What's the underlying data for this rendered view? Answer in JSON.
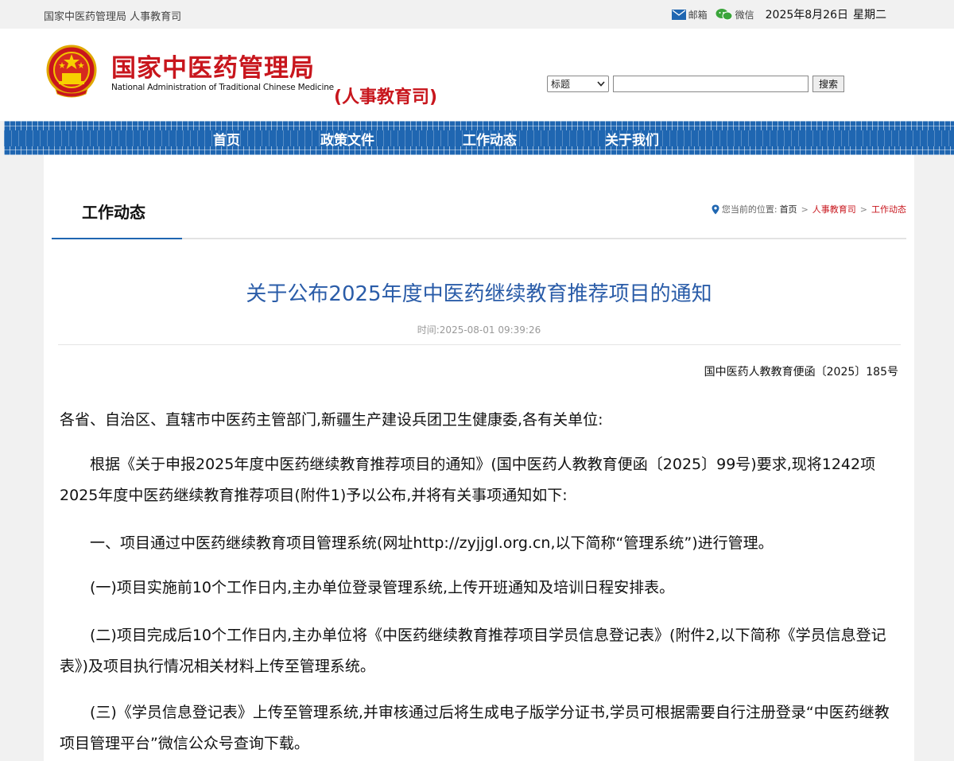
{
  "topbar": {
    "site_label": "国家中医药管理局 人事教育司",
    "mail_label": "邮箱",
    "wechat_label": "微信",
    "date": "2025年8月26日",
    "weekday": "星期二"
  },
  "header": {
    "logo_cn": "国家中医药管理局",
    "logo_en": "National Administration of Traditional Chinese Medicine",
    "logo_sub": "(人事教育司)",
    "search": {
      "select_value": "标题",
      "input_value": "",
      "button_label": "搜索"
    }
  },
  "nav": {
    "items": [
      {
        "label": "首页"
      },
      {
        "label": "政策文件"
      },
      {
        "label": "工作动态"
      },
      {
        "label": "关于我们"
      }
    ]
  },
  "section": {
    "title": "工作动态",
    "breadcrumb": {
      "prefix": "您当前的位置:",
      "home": "首页",
      "level1": "人事教育司",
      "level2": "工作动态",
      "separator": ">"
    }
  },
  "article": {
    "title": "关于公布2025年度中医药继续教育推荐项目的通知",
    "time": "时间:2025-08-01 09:39:26",
    "doc_number": "国中医药人教教育便函〔2025〕185号",
    "paragraphs": [
      "各省、自治区、直辖市中医药主管部门,新疆生产建设兵团卫生健康委,各有关单位:",
      "根据《关于申报2025年度中医药继续教育推荐项目的通知》(国中医药人教教育便函〔2025〕99号)要求,现将1242项2025年度中医药继续教育推荐项目(附件1)予以公布,并将有关事项通知如下:",
      "一、项目通过中医药继续教育项目管理系统(网址http://zyjjgl.org.cn,以下简称“管理系统”)进行管理。",
      "(一)项目实施前10个工作日内,主办单位登录管理系统,上传开班通知及培训日程安排表。",
      "(二)项目完成后10个工作日内,主办单位将《中医药继续教育推荐项目学员信息登记表》(附件2,以下简称《学员信息登记表》)及项目执行情况相关材料上传至管理系统。",
      "(三)《学员信息登记表》上传至管理系统,并审核通过后将生成电子版学分证书,学员可根据需要自行注册登录“中医药继教项目管理平台”微信公众号查询下载。"
    ]
  },
  "colors": {
    "brand_red": "#c8161d",
    "nav_blue": "#1f66b1",
    "title_blue": "#2a5ca8"
  }
}
